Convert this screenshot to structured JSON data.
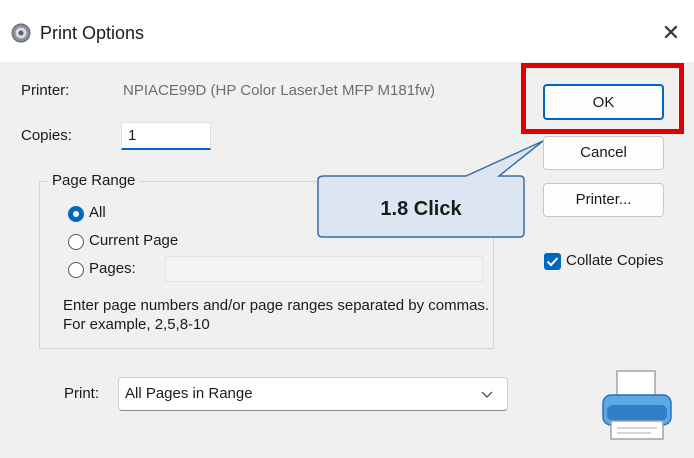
{
  "window": {
    "title": "Print Options",
    "close_glyph": "✕"
  },
  "printer": {
    "label": "Printer:",
    "value": "NPIACE99D (HP Color LaserJet MFP M181fw)"
  },
  "copies": {
    "label": "Copies:",
    "value": "1"
  },
  "page_range": {
    "title": "Page Range",
    "options": [
      {
        "label": "All",
        "selected": true
      },
      {
        "label": "Current Page",
        "selected": false
      },
      {
        "label": "Pages:",
        "selected": false
      }
    ],
    "help_text": "Enter page numbers and/or page ranges separated by commas.  For example, 2,5,8-10"
  },
  "buttons": {
    "ok": "OK",
    "cancel": "Cancel",
    "printer": "Printer..."
  },
  "collate": {
    "label": "Collate Copies",
    "checked": true
  },
  "print": {
    "label": "Print:",
    "value": "All Pages in Range"
  },
  "annotation": {
    "callout_text": "1.8 Click",
    "highlight_color": "#e00000",
    "callout_fill": "#dce6f2"
  },
  "icons": {
    "title": "gear-printer-icon",
    "close": "close-icon",
    "chevron": "chevron-down-icon",
    "printer": "printer-icon",
    "check": "checkmark-icon"
  }
}
